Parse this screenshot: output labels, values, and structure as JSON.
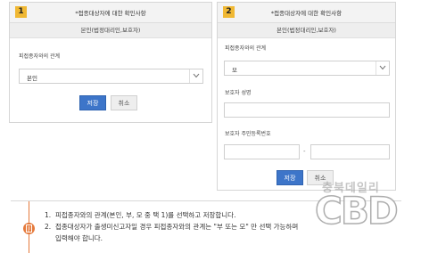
{
  "panel_left": {
    "number": "1",
    "title": "*접종대상자에 대한 확인사항",
    "subtitle": "본인(법정대리인,보호자)",
    "relation_label": "피접종자와의 관계",
    "relation_value": "본인",
    "save_label": "저장",
    "cancel_label": "취소"
  },
  "panel_right": {
    "number": "2",
    "title": "*접종대상자에 대한 확인사항",
    "subtitle": "본인(법정대리인,보호자)",
    "relation_label": "피접종자와의 관계",
    "relation_value": "모",
    "guardian_name_label": "보호자 성명",
    "guardian_id_label": "보호자 주민등록번호",
    "id_separator": "-",
    "save_label": "저장",
    "cancel_label": "취소"
  },
  "notice": {
    "icon": "document-icon",
    "items": [
      {
        "num": "1.",
        "text": "피접종자와의 관계(본인, 부, 모 중 택 1)를 선택하고 저장합니다."
      },
      {
        "num": "2.",
        "text": "접종대상자가 출생미신고자일 경우 피접종자와의 관계는 \"부 또는 모\" 만 선택 가능하며"
      },
      {
        "num": "",
        "text": "입력해야 합니다."
      }
    ]
  },
  "watermark": {
    "top": "충북데일리",
    "big": "CBD"
  },
  "colors": {
    "badge": "#f0b833",
    "primary": "#3d75c9",
    "accent": "#e57a3c"
  }
}
